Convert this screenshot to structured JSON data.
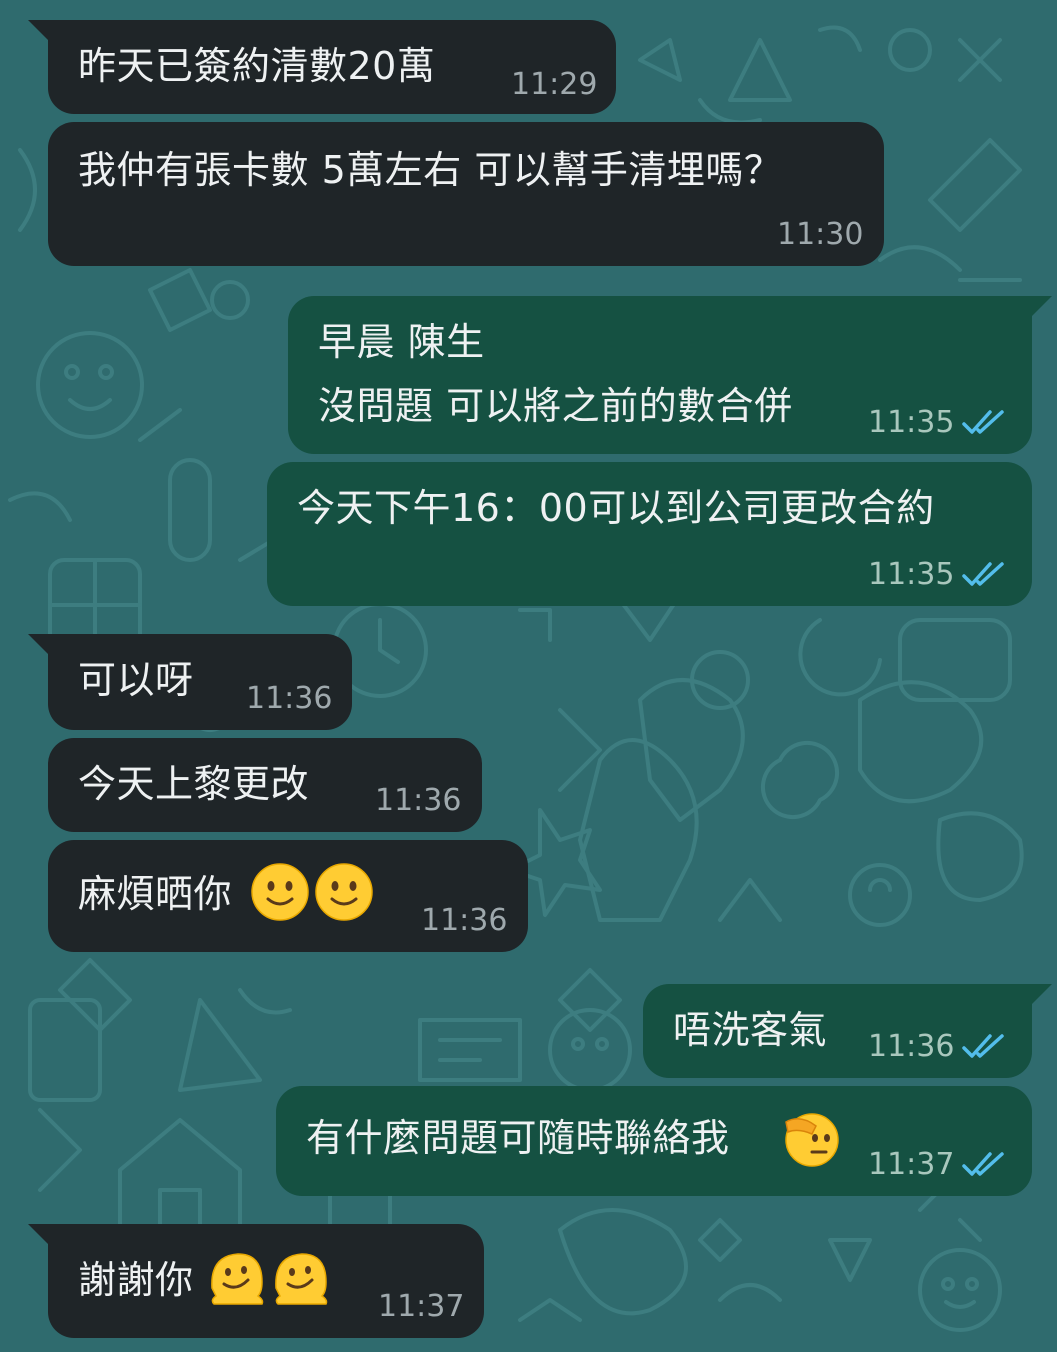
{
  "theme": {
    "wallpaper_color": "#2f6b6e",
    "incoming_bubble_color": "#1f2528",
    "outgoing_bubble_color": "#155142",
    "read_tick_color": "#53bdeb"
  },
  "messages": [
    {
      "direction": "incoming",
      "text": "昨天已簽約清數20萬",
      "time": "11:29"
    },
    {
      "direction": "incoming",
      "text": "我仲有張卡數 5萬左右 可以幫手清埋嗎？",
      "time": "11:30"
    },
    {
      "direction": "outgoing",
      "line1": "早晨 陳生",
      "line2": "沒問題 可以將之前的數合併",
      "time": "11:35",
      "status": "read"
    },
    {
      "direction": "outgoing",
      "text": "今天下午16：00可以到公司更改合約",
      "time": "11:35",
      "status": "read"
    },
    {
      "direction": "incoming",
      "text": "可以呀",
      "time": "11:36"
    },
    {
      "direction": "incoming",
      "text": "今天上黎更改",
      "time": "11:36"
    },
    {
      "direction": "incoming",
      "text": "麻煩晒你",
      "emojis": [
        "slightly-smiling-face",
        "slightly-smiling-face"
      ],
      "time": "11:36"
    },
    {
      "direction": "outgoing",
      "text": "唔洗客氣",
      "time": "11:36",
      "status": "read"
    },
    {
      "direction": "outgoing",
      "text": "有什麼問題可隨時聯絡我",
      "emojis": [
        "saluting-face"
      ],
      "time": "11:37",
      "status": "read"
    },
    {
      "direction": "incoming",
      "text": "謝謝你",
      "emojis": [
        "melting-face",
        "melting-face"
      ],
      "time": "11:37"
    }
  ]
}
